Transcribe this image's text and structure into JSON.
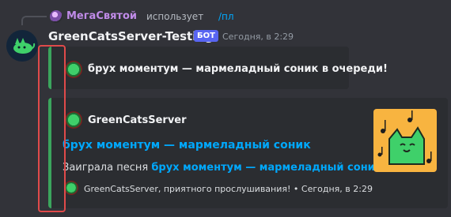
{
  "reply": {
    "username": "МегаСвятой",
    "text": "использует",
    "command": "/пл"
  },
  "message": {
    "username": "GreenCatsServer-Testing!",
    "badge": "БОТ",
    "timestamp": "Сегодня, в 2:29"
  },
  "embed1": {
    "text": "брух моментум — мармеладный соник в очереди!"
  },
  "embed2": {
    "author": "GreenCatsServer",
    "title": "брух моментум — мармеладный соник",
    "desc_prefix": "Заиграла песня ",
    "desc_link": "брух моментум — мармеладный соник",
    "desc_suffix": "!",
    "footer": "GreenCatsServer, приятного прослушивания! • Сегодня, в 2:29"
  },
  "colors": {
    "embed_accent": "#3ba55d",
    "link": "#00a8fc",
    "bot_badge": "#5865f2",
    "highlight": "#e04a4a"
  }
}
